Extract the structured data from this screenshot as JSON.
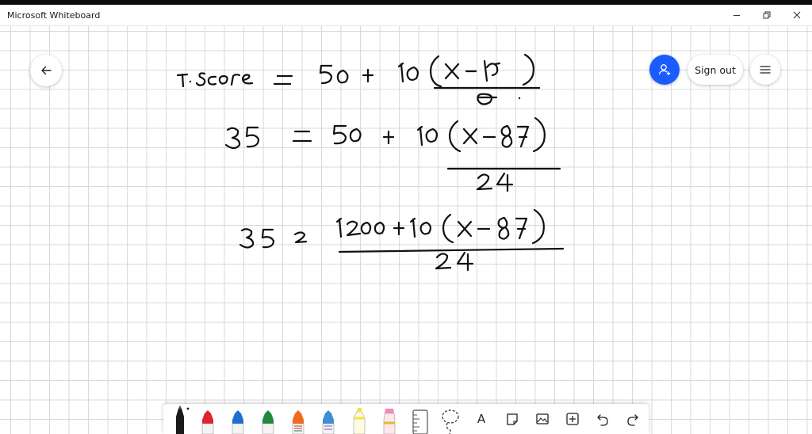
{
  "window": {
    "title": "Microsoft Whiteboard"
  },
  "header": {
    "sign_out_label": "Sign out"
  },
  "icons": {
    "back": "arrow-left-icon",
    "share": "person-add-icon",
    "menu": "hamburger-menu-icon",
    "minimize": "minimize-icon",
    "restore": "restore-icon",
    "close": "close-icon"
  },
  "colors": {
    "accent": "#1a5cff",
    "pens": [
      "#111111",
      "#e0242f",
      "#1f6fd1",
      "#1e8a3a",
      "#ef6a1a",
      "#3b8fd6"
    ],
    "highlighters": [
      "#f2e24a",
      "#f38ab9"
    ]
  },
  "toolbar": {
    "tools": [
      "pen-black",
      "pen-red",
      "pen-blue",
      "pen-green",
      "pen-rainbow",
      "pen-galaxy",
      "highlighter-yellow",
      "highlighter-pink",
      "ruler",
      "lasso",
      "text",
      "sticky-note",
      "image",
      "add",
      "undo",
      "redo"
    ],
    "text_tool_glyph": "A"
  }
}
